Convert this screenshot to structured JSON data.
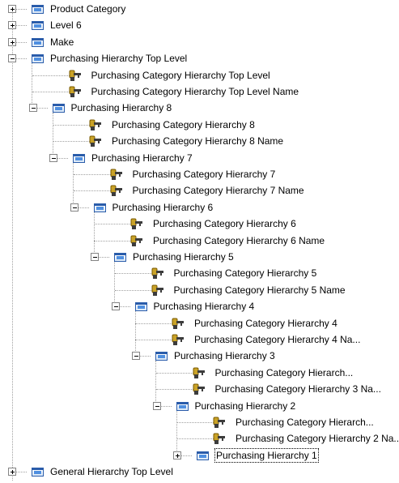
{
  "tree": {
    "nodes": [
      {
        "label": "Product Category",
        "level": 0,
        "type": "folder",
        "expander": "plus"
      },
      {
        "label": "Level 6",
        "level": 0,
        "type": "folder",
        "expander": "plus"
      },
      {
        "label": "Make",
        "level": 0,
        "type": "folder",
        "expander": "plus"
      },
      {
        "label": "Purchasing Hierarchy Top Level",
        "level": 0,
        "type": "folder",
        "expander": "minus"
      },
      {
        "label": "Purchasing Category Hierarchy Top Level",
        "level": 1,
        "type": "key"
      },
      {
        "label": "Purchasing Category Hierarchy Top Level Name",
        "level": 1,
        "type": "key"
      },
      {
        "label": "Purchasing Hierarchy 8",
        "level": 1,
        "type": "folder",
        "expander": "minus"
      },
      {
        "label": "Purchasing Category Hierarchy 8",
        "level": 2,
        "type": "key"
      },
      {
        "label": "Purchasing Category Hierarchy 8 Name",
        "level": 2,
        "type": "key"
      },
      {
        "label": "Purchasing Hierarchy 7",
        "level": 2,
        "type": "folder",
        "expander": "minus"
      },
      {
        "label": "Purchasing Category Hierarchy 7",
        "level": 3,
        "type": "key"
      },
      {
        "label": "Purchasing Category Hierarchy 7 Name",
        "level": 3,
        "type": "key"
      },
      {
        "label": "Purchasing Hierarchy 6",
        "level": 3,
        "type": "folder",
        "expander": "minus"
      },
      {
        "label": "Purchasing Category Hierarchy 6",
        "level": 4,
        "type": "key"
      },
      {
        "label": "Purchasing Category Hierarchy 6 Name",
        "level": 4,
        "type": "key"
      },
      {
        "label": "Purchasing Hierarchy 5",
        "level": 4,
        "type": "folder",
        "expander": "minus"
      },
      {
        "label": "Purchasing Category Hierarchy 5",
        "level": 5,
        "type": "key"
      },
      {
        "label": "Purchasing Category Hierarchy 5 Name",
        "level": 5,
        "type": "key"
      },
      {
        "label": "Purchasing Hierarchy 4",
        "level": 5,
        "type": "folder",
        "expander": "minus"
      },
      {
        "label": "Purchasing Category Hierarchy 4",
        "level": 6,
        "type": "key"
      },
      {
        "label": "Purchasing Category Hierarchy 4 Na...",
        "level": 6,
        "type": "key"
      },
      {
        "label": "Purchasing Hierarchy 3",
        "level": 6,
        "type": "folder",
        "expander": "minus"
      },
      {
        "label": "Purchasing Category Hierarch...",
        "level": 7,
        "type": "key"
      },
      {
        "label": "Purchasing Category Hierarchy 3 Na...",
        "level": 7,
        "type": "key"
      },
      {
        "label": "Purchasing Hierarchy 2",
        "level": 7,
        "type": "folder",
        "expander": "minus"
      },
      {
        "label": "Purchasing Category Hierarch...",
        "level": 8,
        "type": "key"
      },
      {
        "label": "Purchasing Category Hierarchy 2 Na...",
        "level": 8,
        "type": "key"
      },
      {
        "label": "Purchasing Hierarchy 1",
        "level": 8,
        "type": "folder",
        "expander": "plus",
        "selected": true
      },
      {
        "label": "General Hierarchy Top Level",
        "level": 0,
        "type": "folder",
        "expander": "plus"
      }
    ]
  },
  "colors": {
    "folder": "#4f8fe0",
    "key_head": "#c9a227",
    "key_body": "#3c3c3c",
    "lines": "#a0a0a0"
  }
}
